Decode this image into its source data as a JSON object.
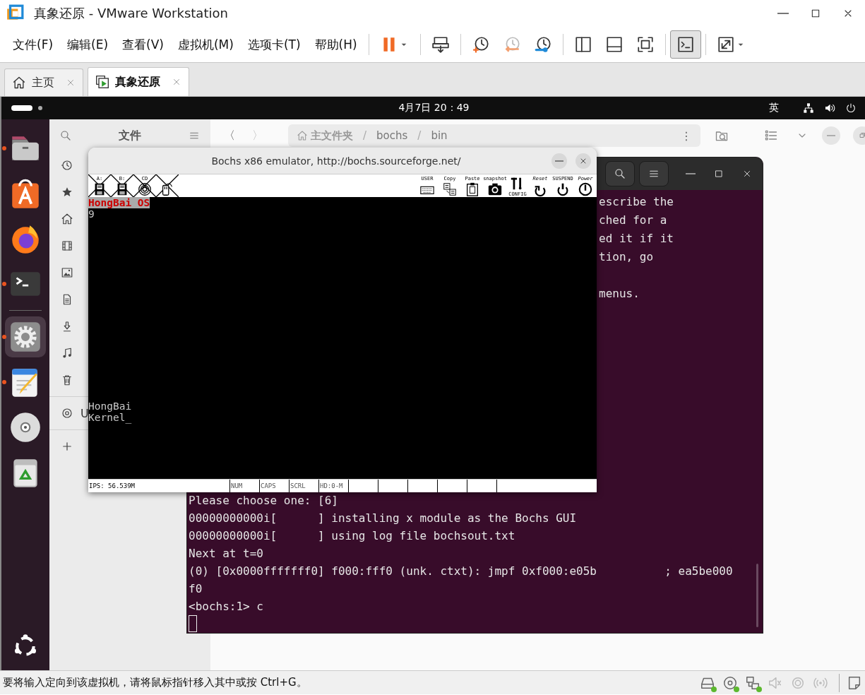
{
  "window": {
    "title": "真象还原 - VMware Workstation"
  },
  "menus": [
    "文件(F)",
    "编辑(E)",
    "查看(V)",
    "虚拟机(M)",
    "选项卡(T)",
    "帮助(H)"
  ],
  "toolbar": [
    {
      "kind": "pause",
      "pressed": false
    },
    {
      "kind": "send",
      "pressed": false
    },
    {
      "kind": "snap-take",
      "pressed": false
    },
    {
      "kind": "snap-revert",
      "pressed": false
    },
    {
      "kind": "snap-manage",
      "pressed": false
    },
    {
      "kind": "view-sidebar",
      "pressed": false
    },
    {
      "kind": "view-bottom",
      "pressed": false
    },
    {
      "kind": "fullscreen",
      "pressed": false
    },
    {
      "kind": "console",
      "pressed": true
    },
    {
      "kind": "stretch",
      "pressed": false
    }
  ],
  "tabs": [
    {
      "label": "主页",
      "kind": "home",
      "selected": false
    },
    {
      "label": "真象还原",
      "kind": "vm",
      "selected": true
    }
  ],
  "guest": {
    "topbar": {
      "clock": "4月7日 20：49",
      "input_method": "英"
    },
    "dock": [
      {
        "kind": "files",
        "running": true,
        "selected": false
      },
      {
        "kind": "appstore",
        "running": false,
        "selected": false
      },
      {
        "kind": "firefox",
        "running": false,
        "selected": false
      },
      {
        "kind": "terminal",
        "running": true,
        "selected": false
      },
      {
        "kind": "settings",
        "running": true,
        "selected": true
      },
      {
        "kind": "editor",
        "running": true,
        "selected": false
      },
      {
        "kind": "disc",
        "running": false,
        "selected": false
      },
      {
        "kind": "trash",
        "running": false,
        "selected": false
      }
    ],
    "files": {
      "title": "文件",
      "sidebar": [
        {
          "kind": "recent"
        },
        {
          "kind": "starred"
        },
        {
          "kind": "home"
        },
        {
          "kind": "videos"
        },
        {
          "kind": "pictures"
        },
        {
          "kind": "documents"
        },
        {
          "kind": "downloads"
        },
        {
          "kind": "music"
        },
        {
          "kind": "trash"
        },
        {
          "kind": "disc",
          "label": "U"
        },
        {
          "kind": "other"
        }
      ],
      "back": "〈",
      "forward": "〉",
      "path": [
        {
          "label": "主文件夹",
          "kind": "home"
        },
        {
          "label": "/",
          "kind": "sep"
        },
        {
          "label": "bochs",
          "kind": "folder"
        },
        {
          "label": "/",
          "kind": "sep"
        },
        {
          "label": "bin",
          "kind": "folder"
        }
      ],
      "path_menu": "⋮"
    },
    "terminal": {
      "partial_lines": [
        "escribe the",
        "ched for a",
        "ed it if it",
        "tion, go"
      ],
      "partial_lines_after_blank": [
        "menus."
      ],
      "lines": [
        "Please choose one: [6]",
        "00000000000i[      ] installing x module as the Bochs GUI",
        "00000000000i[      ] using log file bochsout.txt",
        "Next at t=0",
        "(0) [0x0000fffffff0] f000:fff0 (unk. ctxt): jmpf 0xf000:e05b          ; ea5be000",
        "f0",
        "<bochs:1> c"
      ]
    },
    "bochs": {
      "title": "Bochs x86 emulator, http://bochs.sourceforge.net/",
      "left_tools": [
        {
          "kind": "floppy",
          "label": "A:"
        },
        {
          "kind": "floppy",
          "label": "B:"
        },
        {
          "kind": "cdrom",
          "label": "CD"
        },
        {
          "kind": "mouse"
        }
      ],
      "right_tools": [
        {
          "kind": "keyboard",
          "label": "USER"
        },
        {
          "kind": "copy",
          "label": "Copy"
        },
        {
          "kind": "paste",
          "label": "Paste"
        },
        {
          "kind": "snapshot",
          "label": "snapshot"
        },
        {
          "kind": "config",
          "label": "CONFIG"
        },
        {
          "kind": "reset",
          "label": "Reset"
        },
        {
          "kind": "suspend",
          "label": "SUSPEND"
        },
        {
          "kind": "power",
          "label": "Power"
        }
      ],
      "screen_top": [
        {
          "text": "HongBai OS",
          "highlight": true
        },
        {
          "text": "9",
          "highlight": false
        }
      ],
      "screen_bottom": [
        {
          "text": "HongBai",
          "highlight": false
        },
        {
          "text": "Kernel_",
          "highlight": false
        }
      ],
      "status": [
        "IPS: 56.539M",
        "NUM",
        "CAPS",
        "SCRL",
        "HD:0-M"
      ]
    }
  },
  "status_bar": {
    "message": "要将输入定向到该虚拟机，请将鼠标指针移入其中或按 Ctrl+G。",
    "devices": [
      {
        "kind": "hdd",
        "active": true
      },
      {
        "kind": "cd",
        "active": true
      },
      {
        "kind": "network",
        "active": true
      },
      {
        "kind": "sound",
        "active": false
      },
      {
        "kind": "camera",
        "active": false
      },
      {
        "kind": "wireless",
        "active": false
      }
    ]
  }
}
